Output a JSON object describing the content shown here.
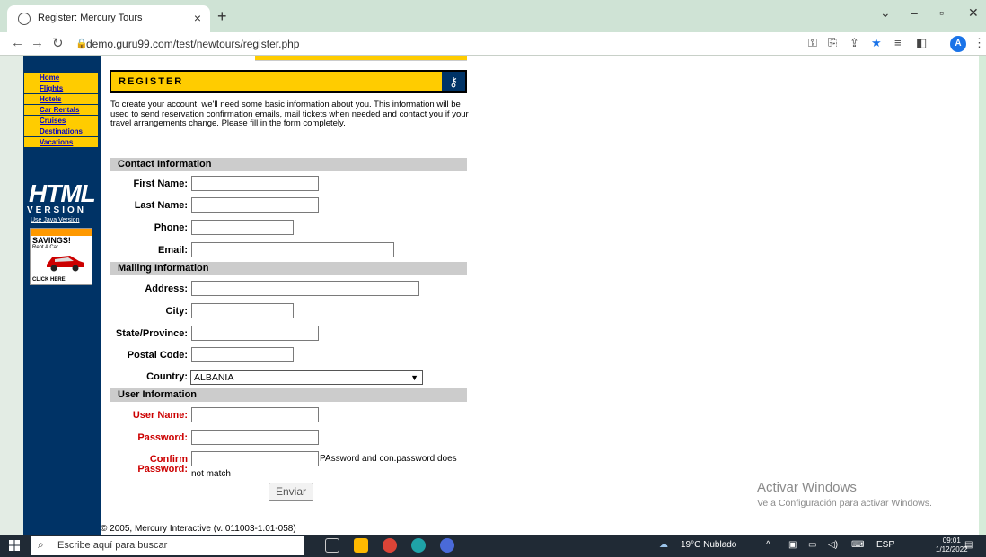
{
  "browser": {
    "tab_title": "Register: Mercury Tours",
    "tab_close": "×",
    "new_tab": "+",
    "url": "demo.guru99.com/test/newtours/register.php",
    "avatar_letter": "A"
  },
  "nav": {
    "items": [
      "Home",
      "Flights",
      "Hotels",
      "Car Rentals",
      "Cruises",
      "Destinations",
      "Vacations"
    ],
    "logo": "HTML",
    "version": "VERSION",
    "java_link": "Use Java Version",
    "ad_title": "SAVINGS!",
    "ad_sub": "Rent A Car",
    "ad_click": "CLICK HERE"
  },
  "page": {
    "header": "REGISTER",
    "intro": "To create your account, we'll need some basic information about you. This information will be used to send reservation confirmation emails, mail tickets when needed and contact you if your travel arrangements change. Please fill in the form completely.",
    "sections": {
      "contact": "Contact Information",
      "mailing": "Mailing Information",
      "user": "User Information"
    },
    "labels": {
      "first_name": "First Name:",
      "last_name": "Last Name:",
      "phone": "Phone:",
      "email": "Email:",
      "address": "Address:",
      "city": "City:",
      "state": "State/Province:",
      "postal": "Postal Code:",
      "country": "Country:",
      "username": "User Name:",
      "password": "Password:",
      "confirm_1": "Confirm",
      "confirm_2": "Password:"
    },
    "country_value": "ALBANIA",
    "error_1": "PAssword and con.password does",
    "error_2": "not match",
    "submit": "Enviar",
    "footer": "© 2005, Mercury Interactive (v. 011003-1.01-058)"
  },
  "watermark": {
    "line1": "Activar Windows",
    "line2": "Ve a Configuración para activar Windows."
  },
  "taskbar": {
    "search_placeholder": "Escribe aquí para buscar",
    "weather": "19°C  Nublado",
    "lang": "ESP",
    "time": "09:01",
    "date": "1/12/2022"
  },
  "colors": {
    "nav_bg": "#003366",
    "accent": "#ffcc00",
    "required": "#cc0000"
  }
}
